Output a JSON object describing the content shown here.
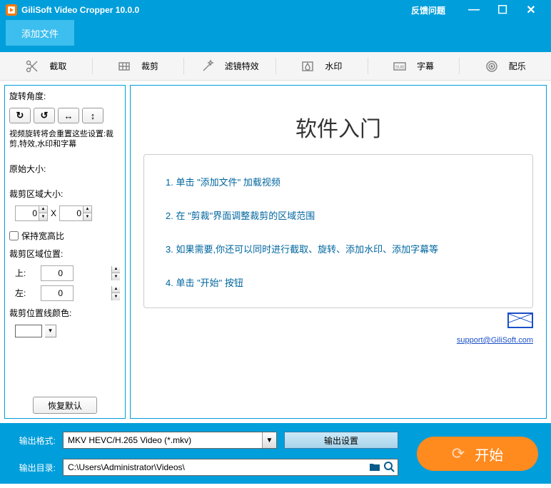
{
  "titlebar": {
    "title": "GiliSoft Video Cropper 10.0.0",
    "feedback": "反馈问题"
  },
  "toolbar": {
    "add_file": "添加文件"
  },
  "tabs": [
    {
      "label": "截取"
    },
    {
      "label": "裁剪"
    },
    {
      "label": "滤镜特效"
    },
    {
      "label": "水印"
    },
    {
      "label": "字幕"
    },
    {
      "label": "配乐"
    }
  ],
  "sidebar": {
    "rotate_label": "旋转角度:",
    "rotate_note": "视频旋转将会重置这些设置:裁剪,特效,水印和字幕",
    "orig_size_label": "原始大小:",
    "crop_size_label": "裁剪区域大小:",
    "width": "0",
    "height": "0",
    "x_sep": "X",
    "keep_ratio": "保持宽高比",
    "crop_pos_label": "裁剪区域位置:",
    "top_label": "上:",
    "left_label": "左:",
    "top": "0",
    "left": "0",
    "line_color_label": "裁剪位置线颜色:",
    "reset": "恢复默认"
  },
  "guide": {
    "title": "软件入门",
    "steps": [
      "1. 单击 \"添加文件\" 加载视频",
      "2. 在 \"剪裁\"界面调整裁剪的区域范围",
      "3. 如果需要,你还可以同时进行截取、旋转、添加水印、添加字幕等",
      "4. 单击 \"开始\" 按钮"
    ],
    "support_link": "support@GiliSoft.com"
  },
  "footer": {
    "format_label": "输出格式:",
    "format_value": "MKV HEVC/H.265 Video (*.mkv)",
    "settings_btn": "输出设置",
    "dir_label": "输出目录:",
    "dir_value": "C:\\Users\\Administrator\\Videos\\",
    "start_btn": "开始"
  }
}
